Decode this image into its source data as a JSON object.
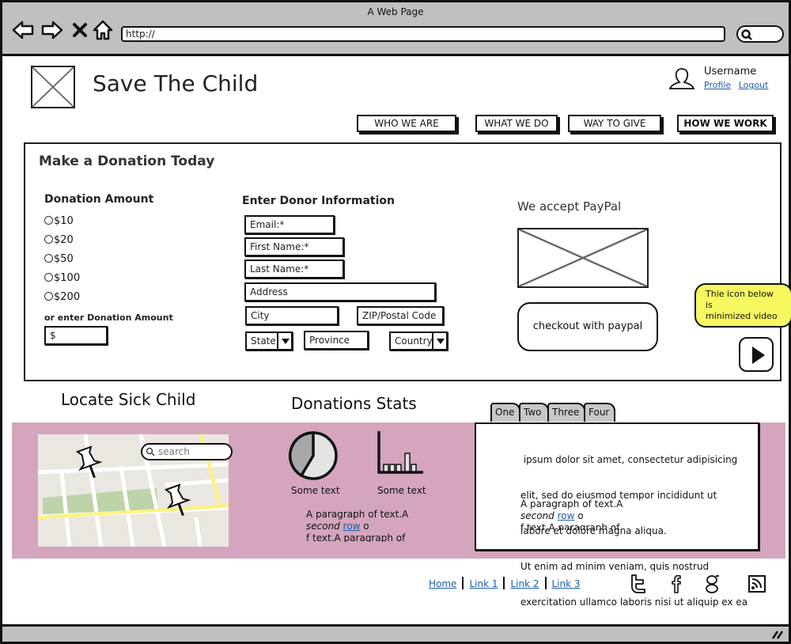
{
  "browser": {
    "window_title": "A Web Page",
    "url": "http://",
    "icons": [
      "back-icon",
      "forward-icon",
      "stop-icon",
      "home-icon",
      "search-icon"
    ]
  },
  "header": {
    "site_title": "Save The Child",
    "username": "Username",
    "profile_link": "Profile",
    "logout_link": "Logout"
  },
  "nav": [
    {
      "label": "WHO WE ARE",
      "active": false
    },
    {
      "label": "WHAT WE DO",
      "active": false
    },
    {
      "label": "WAY TO GIVE",
      "active": false
    },
    {
      "label": "HOW WE WORK",
      "active": true
    }
  ],
  "donation": {
    "title": "Make a Donation Today",
    "amount_title": "Donation Amount",
    "amounts": [
      "$10",
      "$20",
      "$50",
      "$100",
      "$200"
    ],
    "custom_label": "or enter Donation Amount",
    "custom_placeholder": "$",
    "donor_title": "Enter Donor Information",
    "fields": {
      "email": "Email:*",
      "first_name": "First Name:*",
      "last_name": "Last Name:*",
      "address": "Address",
      "city": "City",
      "zip": "ZIP/Postal Code",
      "state": "State",
      "province": "Province",
      "country": "Country"
    },
    "paypal_title": "We accept PayPal",
    "paypal_button": "checkout with paypal",
    "note_lines": [
      "Thie icon below",
      "is",
      "minimized video"
    ]
  },
  "locate": {
    "title": "Locate Sick Child",
    "search_placeholder": "search"
  },
  "stats": {
    "title": "Donations Stats",
    "pie_caption": "Some text",
    "bar_caption": "Some text",
    "paragraph": {
      "line1": "A paragraph of text.A",
      "italic": "second",
      "link": "row",
      "after_link": " o",
      "line3": "f text.A paragraph of"
    }
  },
  "tabs": {
    "labels": [
      "One",
      "Two",
      "Three",
      "Four"
    ],
    "active": "One",
    "lorem": [
      " ipsum dolor sit amet, consectetur adipisicing",
      "elit, sed do eiusmod tempor incididunt ut",
      "labore et dolore magna aliqua.",
      "Ut enim ad minim veniam, quis nostrud",
      "exercitation ullamco laboris nisi ut aliquip ex ea"
    ],
    "paragraph": {
      "line1": "A paragraph of text.A",
      "italic": "second",
      "link": "row",
      "after_link": " o",
      "line3": "f text.A paragraph of"
    }
  },
  "footer": {
    "links": [
      "Home",
      "Link 1",
      "Link 2",
      "Link 3"
    ],
    "social": [
      "twitter-icon",
      "facebook-icon",
      "google-icon",
      "rss-icon"
    ]
  },
  "colors": {
    "pink_band": "#d4a5bd",
    "sticky_note": "#f7f760",
    "link": "#1f5fa8",
    "chrome": "#c0c0c0"
  }
}
